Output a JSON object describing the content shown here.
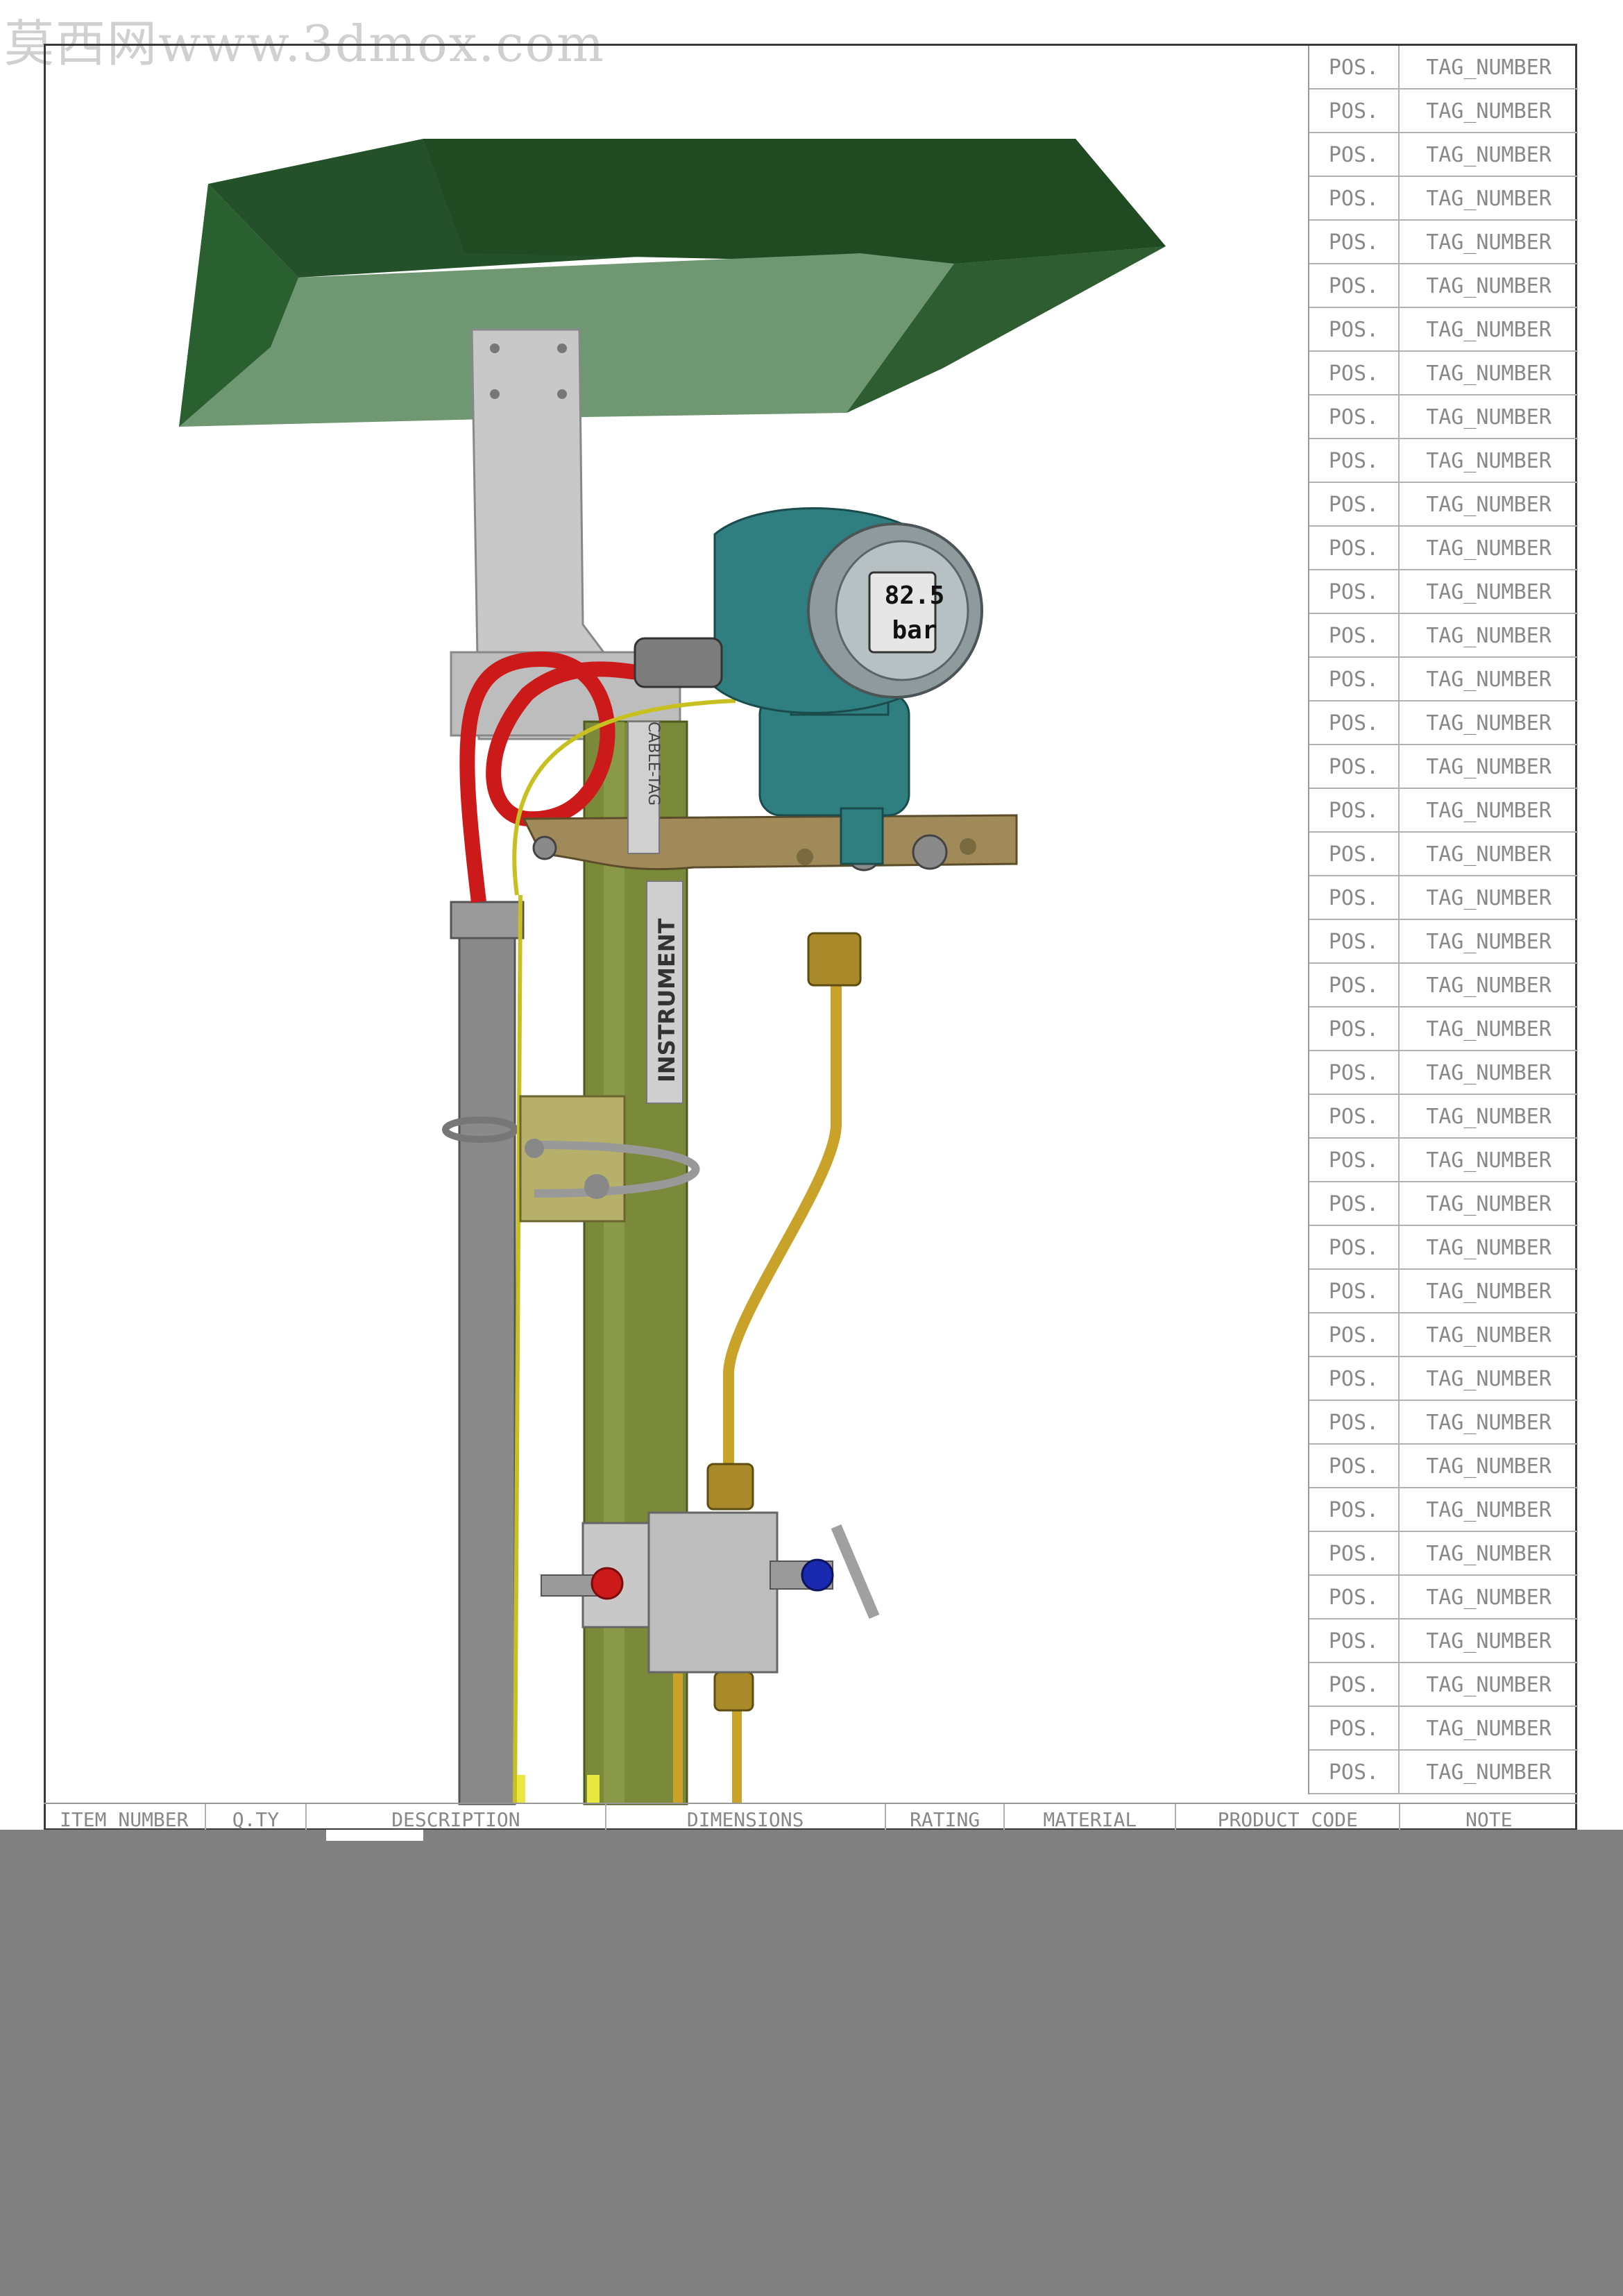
{
  "watermark": "莫西网www.3dmox.com",
  "display": {
    "value": "82.5",
    "unit": "bar"
  },
  "labels": {
    "cable_tag": "CABLE-TAG",
    "instrument": "INSTRUMENT"
  },
  "tag_rows": [
    {
      "pos": "POS.",
      "tag": "TAG_NUMBER"
    },
    {
      "pos": "POS.",
      "tag": "TAG_NUMBER"
    },
    {
      "pos": "POS.",
      "tag": "TAG_NUMBER"
    },
    {
      "pos": "POS.",
      "tag": "TAG_NUMBER"
    },
    {
      "pos": "POS.",
      "tag": "TAG_NUMBER"
    },
    {
      "pos": "POS.",
      "tag": "TAG_NUMBER"
    },
    {
      "pos": "POS.",
      "tag": "TAG_NUMBER"
    },
    {
      "pos": "POS.",
      "tag": "TAG_NUMBER"
    },
    {
      "pos": "POS.",
      "tag": "TAG_NUMBER"
    },
    {
      "pos": "POS.",
      "tag": "TAG_NUMBER"
    },
    {
      "pos": "POS.",
      "tag": "TAG_NUMBER"
    },
    {
      "pos": "POS.",
      "tag": "TAG_NUMBER"
    },
    {
      "pos": "POS.",
      "tag": "TAG_NUMBER"
    },
    {
      "pos": "POS.",
      "tag": "TAG_NUMBER"
    },
    {
      "pos": "POS.",
      "tag": "TAG_NUMBER"
    },
    {
      "pos": "POS.",
      "tag": "TAG_NUMBER"
    },
    {
      "pos": "POS.",
      "tag": "TAG_NUMBER"
    },
    {
      "pos": "POS.",
      "tag": "TAG_NUMBER"
    },
    {
      "pos": "POS.",
      "tag": "TAG_NUMBER"
    },
    {
      "pos": "POS.",
      "tag": "TAG_NUMBER"
    },
    {
      "pos": "POS.",
      "tag": "TAG_NUMBER"
    },
    {
      "pos": "POS.",
      "tag": "TAG_NUMBER"
    },
    {
      "pos": "POS.",
      "tag": "TAG_NUMBER"
    },
    {
      "pos": "POS.",
      "tag": "TAG_NUMBER"
    },
    {
      "pos": "POS.",
      "tag": "TAG_NUMBER"
    },
    {
      "pos": "POS.",
      "tag": "TAG_NUMBER"
    },
    {
      "pos": "POS.",
      "tag": "TAG_NUMBER"
    },
    {
      "pos": "POS.",
      "tag": "TAG_NUMBER"
    },
    {
      "pos": "POS.",
      "tag": "TAG_NUMBER"
    },
    {
      "pos": "POS.",
      "tag": "TAG_NUMBER"
    },
    {
      "pos": "POS.",
      "tag": "TAG_NUMBER"
    },
    {
      "pos": "POS.",
      "tag": "TAG_NUMBER"
    },
    {
      "pos": "POS.",
      "tag": "TAG_NUMBER"
    },
    {
      "pos": "POS.",
      "tag": "TAG_NUMBER"
    },
    {
      "pos": "POS.",
      "tag": "TAG_NUMBER"
    },
    {
      "pos": "POS.",
      "tag": "TAG_NUMBER"
    },
    {
      "pos": "POS.",
      "tag": "TAG_NUMBER"
    },
    {
      "pos": "POS.",
      "tag": "TAG_NUMBER"
    },
    {
      "pos": "POS.",
      "tag": "TAG_NUMBER"
    },
    {
      "pos": "POS.",
      "tag": "TAG_NUMBER"
    }
  ],
  "bom_columns": [
    "ITEM_NUMBER",
    "Q.TY",
    "DESCRIPTION",
    "DIMENSIONS",
    "RATING",
    "MATERIAL",
    "PRODUCT_CODE",
    "NOTE"
  ],
  "colors": {
    "canopy_dark": "#1f4a22",
    "canopy_light": "#6e9772",
    "pole": "#7a8a3a",
    "transmitter": "#2f7e80",
    "bracket": "#a08a5a",
    "tubing": "#c9a22a",
    "cable_red": "#cc1a1a",
    "cable_yellow": "#c8c020",
    "conduit": "#8a8a8a",
    "background_band": "#808080"
  }
}
